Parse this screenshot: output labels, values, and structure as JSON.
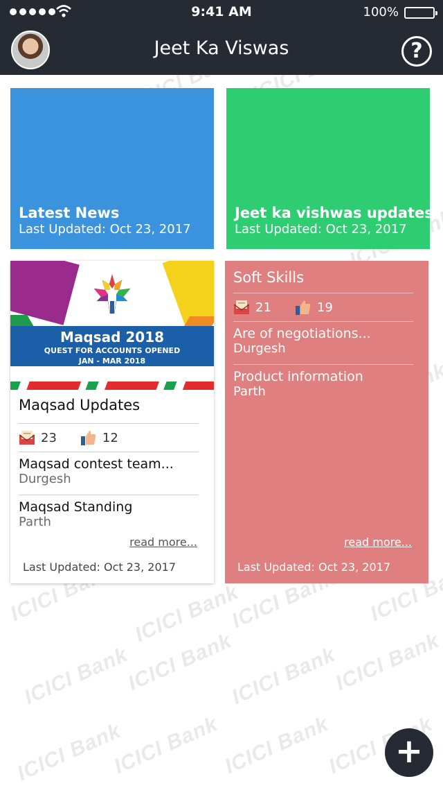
{
  "status_bar": {
    "time": "9:41 AM",
    "battery": "100%"
  },
  "header": {
    "title": "Jeet Ka Viswas",
    "help_label": "?"
  },
  "watermark_text": "ICICI Bank",
  "tiles": [
    {
      "title": "Latest News",
      "updated": "Last Updated: Oct 23, 2017",
      "color": "#3a93dc"
    },
    {
      "title": "Jeet ka vishwas updates",
      "updated": "Last Updated: Oct 23, 2017",
      "color": "#2fcd71"
    }
  ],
  "maqsad_card": {
    "banner": {
      "line1": "Maqsad 2018",
      "line2": "QUEST FOR ACCOUNTS OPENED",
      "line3": "JAN - MAR 2018"
    },
    "title": "Maqsad Updates",
    "mail_count": "23",
    "like_count": "12",
    "items": [
      {
        "title": "Maqsad contest team...",
        "author": "Durgesh"
      },
      {
        "title": "Maqsad Standing",
        "author": "Parth"
      }
    ],
    "read_more": "read more...",
    "updated": "Last Updated: Oct 23, 2017"
  },
  "soft_skills_card": {
    "title": "Soft Skills",
    "color": "#e07f7f",
    "mail_count": "21",
    "like_count": "19",
    "items": [
      {
        "title": "Are of negotiations...",
        "author": "Durgesh"
      },
      {
        "title": "Product information",
        "author": "Parth"
      }
    ],
    "read_more": "read more...",
    "updated": "Last Updated: Oct 23, 2017"
  },
  "fab_label": "+"
}
